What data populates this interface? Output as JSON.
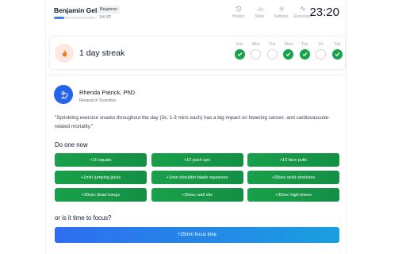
{
  "header": {
    "user_name": "Benjamin Gelb",
    "level": "Beginner",
    "xp_text": "1/4 XP",
    "xp_progress": 0.25,
    "clock": "23:20",
    "nav": [
      {
        "label": "History",
        "icon": "history-icon"
      },
      {
        "label": "Stats",
        "icon": "stats-icon"
      },
      {
        "label": "Settings",
        "icon": "gear-icon"
      },
      {
        "label": "Exercises",
        "icon": "activity-icon"
      }
    ]
  },
  "streak": {
    "text": "1 day streak",
    "days": [
      {
        "label": "Sun",
        "done": true
      },
      {
        "label": "Mon",
        "done": false
      },
      {
        "label": "Tue",
        "done": false
      },
      {
        "label": "Wed",
        "done": true
      },
      {
        "label": "Thu",
        "done": true
      },
      {
        "label": "Fri",
        "done": false
      },
      {
        "label": "Sat",
        "done": true
      }
    ]
  },
  "expert": {
    "name": "Rhenda Patrick, PhD",
    "role": "Research Scientist",
    "quote": "\"Sprinkling exercise snacks throughout the day (3x, 1-3 mins each) has a big impact on lowering cancer- and cardiovascular-related mortality.\""
  },
  "do_now": {
    "title": "Do one now",
    "exercises": [
      "+10 squats",
      "+10 push ups",
      "+10 face pulls",
      "+1min jumping jacks",
      "+1min shoulder blade squeezes",
      "+30sec wrist stretches",
      "+30sec dead hangs",
      "+30sec wall sits",
      "+30sec high knees"
    ]
  },
  "focus": {
    "title": "or is it time to focus?",
    "button_label": "+25min focus time"
  },
  "colors": {
    "accent_blue": "#2563eb",
    "success_green": "#16a34a",
    "flame_bg": "#fde8df"
  }
}
